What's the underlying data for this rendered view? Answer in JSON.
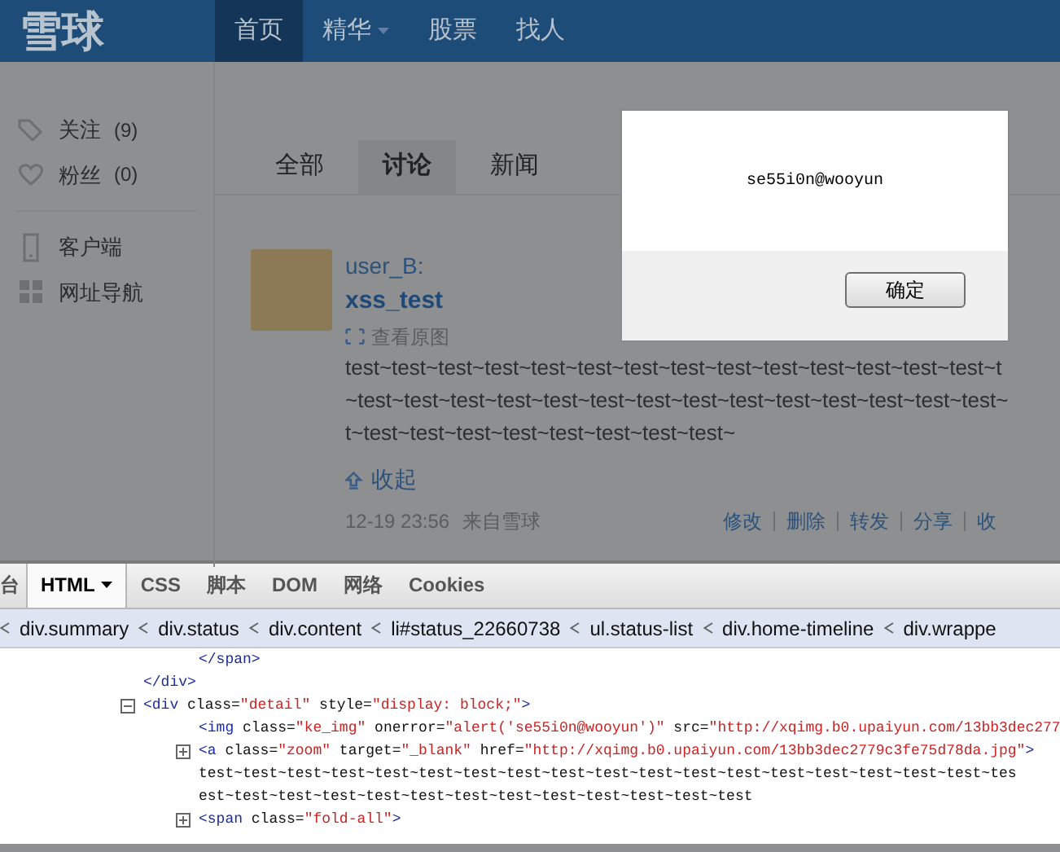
{
  "header": {
    "logo": "雪球",
    "nav": [
      {
        "label": "首页",
        "selected": true,
        "caret": false
      },
      {
        "label": "精华",
        "selected": false,
        "caret": true
      },
      {
        "label": "股票",
        "selected": false,
        "caret": false
      },
      {
        "label": "找人",
        "selected": false,
        "caret": false
      }
    ]
  },
  "sidebar": {
    "items": [
      {
        "kind": "tag",
        "label": "关注",
        "count": "(9)"
      },
      {
        "kind": "heart",
        "label": "粉丝",
        "count": "(0)"
      },
      {
        "kind": "phone",
        "label": "客户端"
      },
      {
        "kind": "grid",
        "label": "网址导航"
      }
    ]
  },
  "tabs": [
    {
      "label": "全部",
      "selected": false
    },
    {
      "label": "讨论",
      "selected": true
    },
    {
      "label": "新闻",
      "selected": false
    }
  ],
  "post": {
    "user": "user_B:",
    "title": "xss_test",
    "view_original": "查看原图",
    "lines": [
      "test~test~test~test~test~test~test~test~test~test~test~test~test~test~t",
      "~test~test~test~test~test~test~test~test~test~test~test~test~test~test~",
      "t~test~test~test~test~test~test~test~test~"
    ],
    "collapse": "收起",
    "time": "12-19 23:56",
    "source": "来自雪球",
    "actions": [
      "修改",
      "删除",
      "转发",
      "分享",
      "收"
    ]
  },
  "dialog": {
    "message": "se55i0n@wooyun",
    "button": "确定"
  },
  "devtools": {
    "tabs": [
      {
        "label": "台",
        "selected": false,
        "caret": false
      },
      {
        "label": "HTML",
        "selected": true,
        "caret": true
      },
      {
        "label": "CSS",
        "selected": false,
        "caret": false
      },
      {
        "label": "脚本",
        "selected": false,
        "caret": false
      },
      {
        "label": "DOM",
        "selected": false,
        "caret": false
      },
      {
        "label": "网络",
        "selected": false,
        "caret": false
      },
      {
        "label": "Cookies",
        "selected": false,
        "caret": false
      }
    ],
    "breadcrumb": [
      "div.summary",
      "div.status",
      "div.content",
      "li#status_22660738",
      "ul.status-list",
      "div.home-timeline",
      "div.wrappe"
    ],
    "code": [
      {
        "kind": "close",
        "tokens": [
          {
            "kind": "tag",
            "text": "</div>"
          }
        ],
        "children": [
          {
            "kind": "close",
            "tokens": [
              {
                "kind": "tag",
                "text": "</span>"
              }
            ]
          }
        ]
      },
      {
        "kind": "open",
        "expanded": true,
        "tokens": [
          {
            "kind": "tag",
            "text": "<div "
          },
          {
            "kind": "attr",
            "text": "class="
          },
          {
            "kind": "value",
            "text": "\"detail\""
          },
          {
            "kind": "attr",
            "text": " style="
          },
          {
            "kind": "value",
            "text": "\"display: block;\""
          },
          {
            "kind": "tag",
            "text": ">"
          }
        ],
        "children": [
          {
            "kind": "leaf",
            "tokens": [
              {
                "kind": "tag",
                "text": "<img "
              },
              {
                "kind": "attr",
                "text": "class="
              },
              {
                "kind": "value",
                "text": "\"ke_img\""
              },
              {
                "kind": "attr",
                "text": " onerror="
              },
              {
                "kind": "value",
                "text": "\"alert('se55i0n@wooyun')\""
              },
              {
                "kind": "attr",
                "text": " src="
              },
              {
                "kind": "value",
                "text": "\"http://xqimg.b0.upaiyun.com/13bb3dec277"
              }
            ]
          },
          {
            "kind": "open",
            "expanded": false,
            "tokens": [
              {
                "kind": "tag",
                "text": "<a "
              },
              {
                "kind": "attr",
                "text": "class="
              },
              {
                "kind": "value",
                "text": "\"zoom\""
              },
              {
                "kind": "attr",
                "text": " target="
              },
              {
                "kind": "value",
                "text": "\"_blank\""
              },
              {
                "kind": "attr",
                "text": " href="
              },
              {
                "kind": "value",
                "text": "\"http://xqimg.b0.upaiyun.com/13bb3dec2779c3fe75d78da.jpg\""
              },
              {
                "kind": "tag",
                "text": ">"
              }
            ]
          },
          {
            "kind": "leaf",
            "tokens": [
              {
                "kind": "text",
                "text": "test~test~test~test~test~test~test~test~test~test~test~test~test~test~test~test~test~test~tes"
              }
            ]
          },
          {
            "kind": "leaf",
            "tokens": [
              {
                "kind": "text",
                "text": "est~test~test~test~test~test~test~test~test~test~test~test~test"
              }
            ]
          },
          {
            "kind": "open",
            "expanded": false,
            "tokens": [
              {
                "kind": "tag",
                "text": "<span "
              },
              {
                "kind": "attr",
                "text": "class="
              },
              {
                "kind": "value",
                "text": "\"fold-all\""
              },
              {
                "kind": "tag",
                "text": ">"
              }
            ]
          }
        ]
      }
    ]
  }
}
